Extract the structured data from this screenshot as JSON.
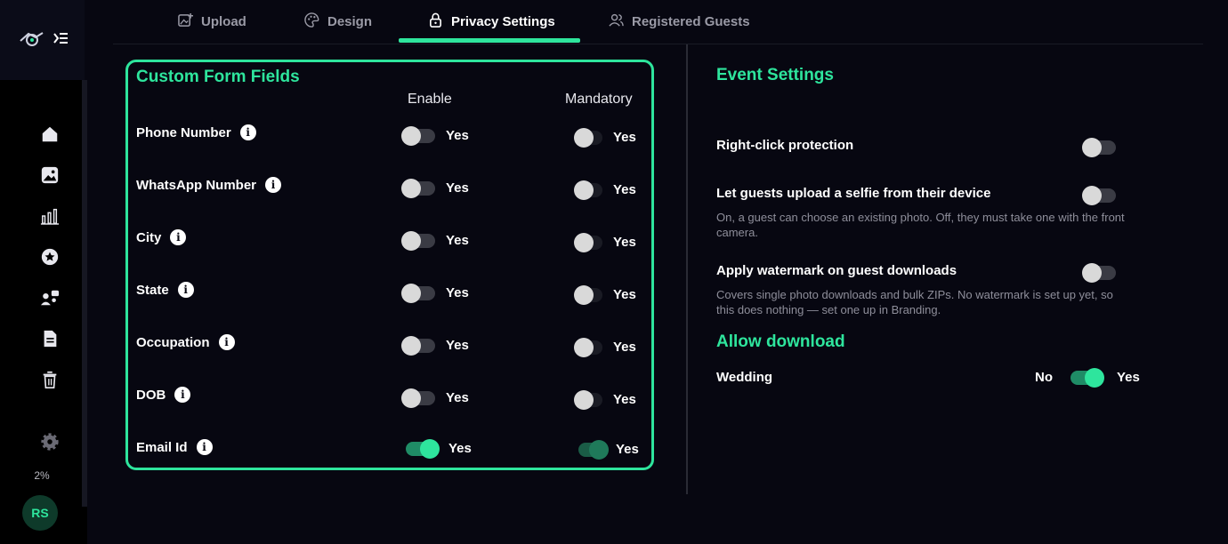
{
  "sidebar": {
    "top_icons": [
      "logo-icon",
      "collapse-menu-icon"
    ],
    "items": [
      {
        "name": "home-icon"
      },
      {
        "name": "image-icon"
      },
      {
        "name": "bar-chart-icon"
      },
      {
        "name": "star-icon"
      },
      {
        "name": "users-icon"
      },
      {
        "name": "document-icon"
      },
      {
        "name": "trash-icon"
      }
    ],
    "settings_icon": "gear-icon",
    "storage_percent": "2%",
    "avatar_initials": "RS"
  },
  "tabs": [
    {
      "label": "Upload",
      "icon": "upload-image-icon"
    },
    {
      "label": "Design",
      "icon": "palette-icon"
    },
    {
      "label": "Privacy Settings",
      "icon": "lock-icon",
      "active": true
    },
    {
      "label": "Registered Guests",
      "icon": "users-icon"
    }
  ],
  "custom_fields": {
    "title": "Custom Form Fields",
    "enable_header": "Enable",
    "mandatory_header": "Mandatory",
    "rows": [
      {
        "label": "Phone Number",
        "enable": false,
        "enable_label": "Yes",
        "mandatory": false,
        "mandatory_label": "Yes"
      },
      {
        "label": "WhatsApp Number",
        "enable": false,
        "enable_label": "Yes",
        "mandatory": false,
        "mandatory_label": "Yes"
      },
      {
        "label": "City",
        "enable": false,
        "enable_label": "Yes",
        "mandatory": false,
        "mandatory_label": "Yes"
      },
      {
        "label": "State",
        "enable": false,
        "enable_label": "Yes",
        "mandatory": false,
        "mandatory_label": "Yes"
      },
      {
        "label": "Occupation",
        "enable": false,
        "enable_label": "Yes",
        "mandatory": false,
        "mandatory_label": "Yes"
      },
      {
        "label": "DOB",
        "enable": false,
        "enable_label": "Yes",
        "mandatory": false,
        "mandatory_label": "Yes"
      },
      {
        "label": "Email Id",
        "enable": true,
        "enable_label": "Yes",
        "mandatory": true,
        "mandatory_label": "Yes"
      }
    ]
  },
  "event_settings": {
    "title": "Event Settings",
    "right_click": {
      "label": "Right-click protection",
      "on": false
    },
    "selfie_upload": {
      "label": "Let guests upload a selfie from their device",
      "description": "On, a guest can choose an existing photo. Off, they must take one with the front camera.",
      "on": false
    },
    "watermark": {
      "label": "Apply watermark on guest downloads",
      "description": "Covers single photo downloads and bulk ZIPs. No watermark is set up yet, so this does nothing — set one up in Branding.",
      "on": false
    }
  },
  "allow_download": {
    "title": "Allow download",
    "rows": [
      {
        "label": "Wedding",
        "no_label": "No",
        "yes_label": "Yes",
        "on": true
      }
    ]
  },
  "colors": {
    "accent": "#2ee59d",
    "background": "#070711",
    "sidebar": "#000000"
  }
}
